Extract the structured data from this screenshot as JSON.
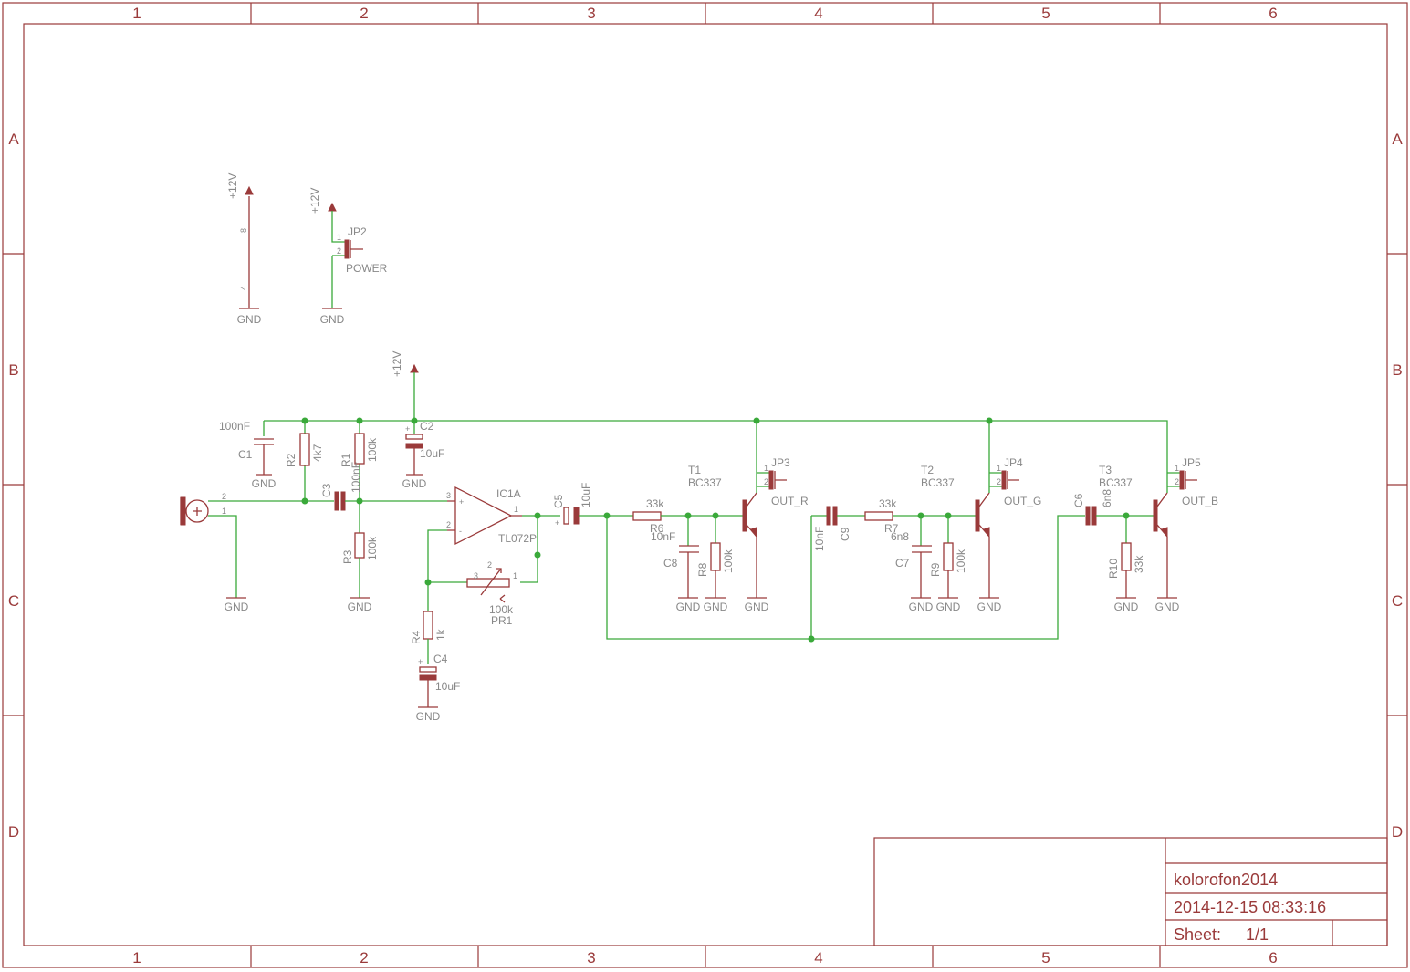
{
  "frame": {
    "columns": [
      "1",
      "2",
      "3",
      "4",
      "5",
      "6"
    ],
    "rows": [
      "A",
      "B",
      "C",
      "D"
    ]
  },
  "title_block": {
    "name": "kolorofon2014",
    "date": "2014-12-15 08:33:16",
    "sheet_label": "Sheet:",
    "sheet_value": "1/1"
  },
  "labels": {
    "supply": "+12V",
    "gnd": "GND",
    "pin8": "8",
    "pin4": "4",
    "jp2": "JP2",
    "power": "POWER",
    "c1": "C1",
    "c1_val": "100nF",
    "r2": "R2",
    "r2_val": "4k7",
    "r1": "R1",
    "r1_val": "100k",
    "c2": "C2",
    "c2_val": "10uF",
    "c3": "C3",
    "c3_val": "100nF",
    "r3": "R3",
    "r3_val": "100k",
    "ic1": "IC1A",
    "ic1_val": "TL072P",
    "pr1": "PR1",
    "pr1_val": "100k",
    "r4": "R4",
    "r4_val": "1k",
    "c4": "C4",
    "c4_val": "10uF",
    "c5": "C5",
    "c5_val": "10uF",
    "r6": "R6",
    "r6_val": "33k",
    "c8": "C8",
    "c8_val": "10nF",
    "r8": "R8",
    "r8_val": "100k",
    "t1": "T1",
    "t_val": "BC337",
    "jp3": "JP3",
    "out_r": "OUT_R",
    "c9": "C9",
    "c9_val": "10nF",
    "r7": "R7",
    "r7_val": "33k",
    "c7": "C7",
    "c7_val": "6n8",
    "r9": "R9",
    "r9_val": "100k",
    "t2": "T2",
    "jp4": "JP4",
    "out_g": "OUT_G",
    "c6": "C6",
    "c6_val": "6n8",
    "r10": "R10",
    "r10_val": "33k",
    "t3": "T3",
    "jp5": "JP5",
    "out_b": "OUT_B",
    "p1": "1",
    "p2": "2",
    "p3": "3",
    "plus": "+",
    "minus": "-"
  },
  "colors": {
    "frame": "#9a3a3a",
    "wire": "#3aa93a",
    "component": "#9a3a3a",
    "text": "#888888"
  }
}
